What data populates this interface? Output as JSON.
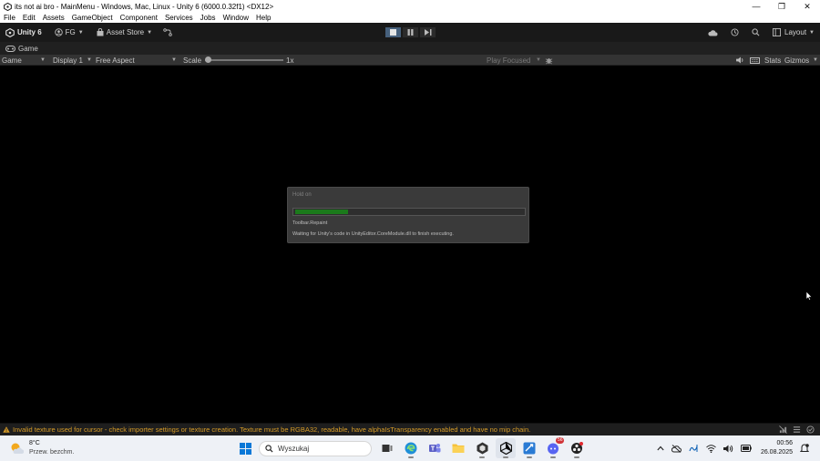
{
  "window": {
    "title": "its not ai bro - MainMenu - Windows, Mac, Linux - Unity 6 (6000.0.32f1) <DX12>",
    "minimize_glyph": "—",
    "restore_glyph": "❐",
    "close_glyph": "✕"
  },
  "menu": {
    "items": [
      "File",
      "Edit",
      "Assets",
      "GameObject",
      "Component",
      "Services",
      "Jobs",
      "Window",
      "Help"
    ]
  },
  "toolbar": {
    "unity_label": "Unity 6",
    "account_label": "FG",
    "asset_store_label": "Asset Store",
    "layout_label": "Layout"
  },
  "tab": {
    "label": "Game"
  },
  "game_bar": {
    "view_select": "Game",
    "display_select": "Display 1",
    "aspect_select": "Free Aspect",
    "scale_label": "Scale",
    "scale_value": "1x",
    "scale_fraction": 0.0,
    "play_focused": "Play Focused",
    "stats_label": "Stats",
    "gizmos_label": "Gizmos"
  },
  "dialog": {
    "title": "Hold on",
    "progress_fraction": 0.23,
    "step": "Toolbar.Repaint",
    "message": "Waiting for Unity's code in UnityEditor.CoreModule.dll to finish executing."
  },
  "status": {
    "message": "Invalid texture used for cursor - check importer settings or texture creation. Texture must be RGBA32, readable, have alphaIsTransparency enabled and have no mip chain.",
    "color": "#d89d28"
  },
  "taskbar": {
    "temperature": "8°C",
    "weather_desc": "Przew. bezchm.",
    "search_placeholder": "Wyszukaj",
    "discord_badge": "56",
    "time": "00:56",
    "date": "26.08.2025"
  },
  "colors": {
    "progress_fill": "#1b7a1b",
    "toolbar_bg": "#191919",
    "play_active": "#46607c"
  }
}
